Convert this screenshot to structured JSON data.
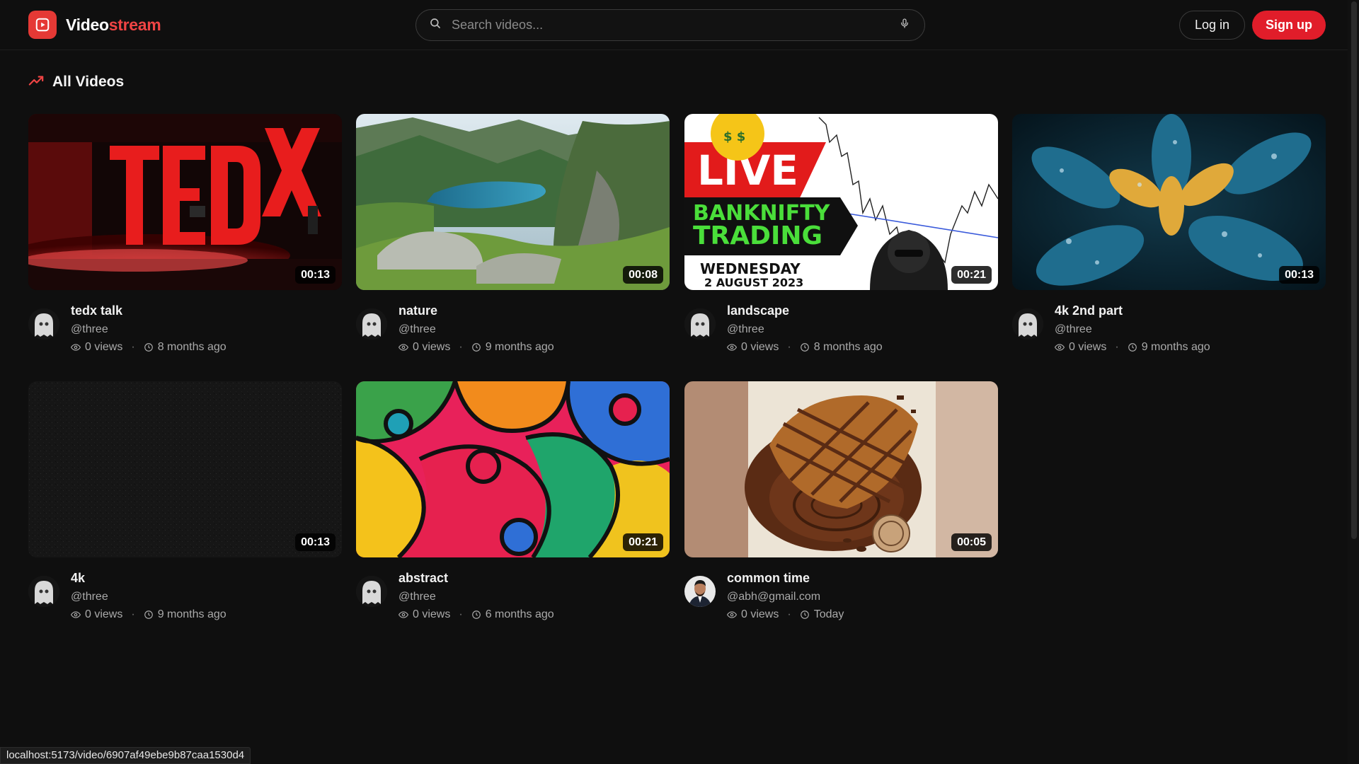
{
  "brand": {
    "name_prefix": "Video",
    "name_suffix": "stream",
    "accent_color": "#e11d2a"
  },
  "header": {
    "search_placeholder": "Search videos...",
    "login_label": "Log in",
    "signup_label": "Sign up"
  },
  "section": {
    "title": "All Videos",
    "icon": "trending-up-icon"
  },
  "videos": [
    {
      "title": "tedx talk",
      "channel": "@three",
      "views": "0 views",
      "age": "8 months ago",
      "duration": "00:13",
      "thumbnail": "tedx-stage",
      "avatar": "ghost"
    },
    {
      "title": "nature",
      "channel": "@three",
      "views": "0 views",
      "age": "9 months ago",
      "duration": "00:08",
      "thumbnail": "mountain-lake",
      "avatar": "ghost"
    },
    {
      "title": "landscape",
      "channel": "@three",
      "views": "0 views",
      "age": "8 months ago",
      "duration": "00:21",
      "thumbnail": "live-trading",
      "avatar": "ghost",
      "thumb_text": {
        "live": "LIVE",
        "line1": "BANKNIFTY",
        "line2": "TRADING",
        "day": "WEDNESDAY",
        "date": "2 AUGUST 2023"
      }
    },
    {
      "title": "4k 2nd part",
      "channel": "@three",
      "views": "0 views",
      "age": "9 months ago",
      "duration": "00:13",
      "thumbnail": "blue-leaves",
      "avatar": "ghost"
    },
    {
      "title": "4k",
      "channel": "@three",
      "views": "0 views",
      "age": "9 months ago",
      "duration": "00:13",
      "thumbnail": "dark-texture",
      "avatar": "ghost"
    },
    {
      "title": "abstract",
      "channel": "@three",
      "views": "0 views",
      "age": "6 months ago",
      "duration": "00:21",
      "thumbnail": "abstract-color",
      "avatar": "ghost"
    },
    {
      "title": "common time",
      "channel": "@abh@gmail.com",
      "views": "0 views",
      "age": "Today",
      "duration": "00:05",
      "thumbnail": "chocolate-waffle",
      "avatar": "man-photo"
    }
  ],
  "status_bar": {
    "url": "localhost:5173/video/6907af49ebe9b87caa1530d4"
  }
}
